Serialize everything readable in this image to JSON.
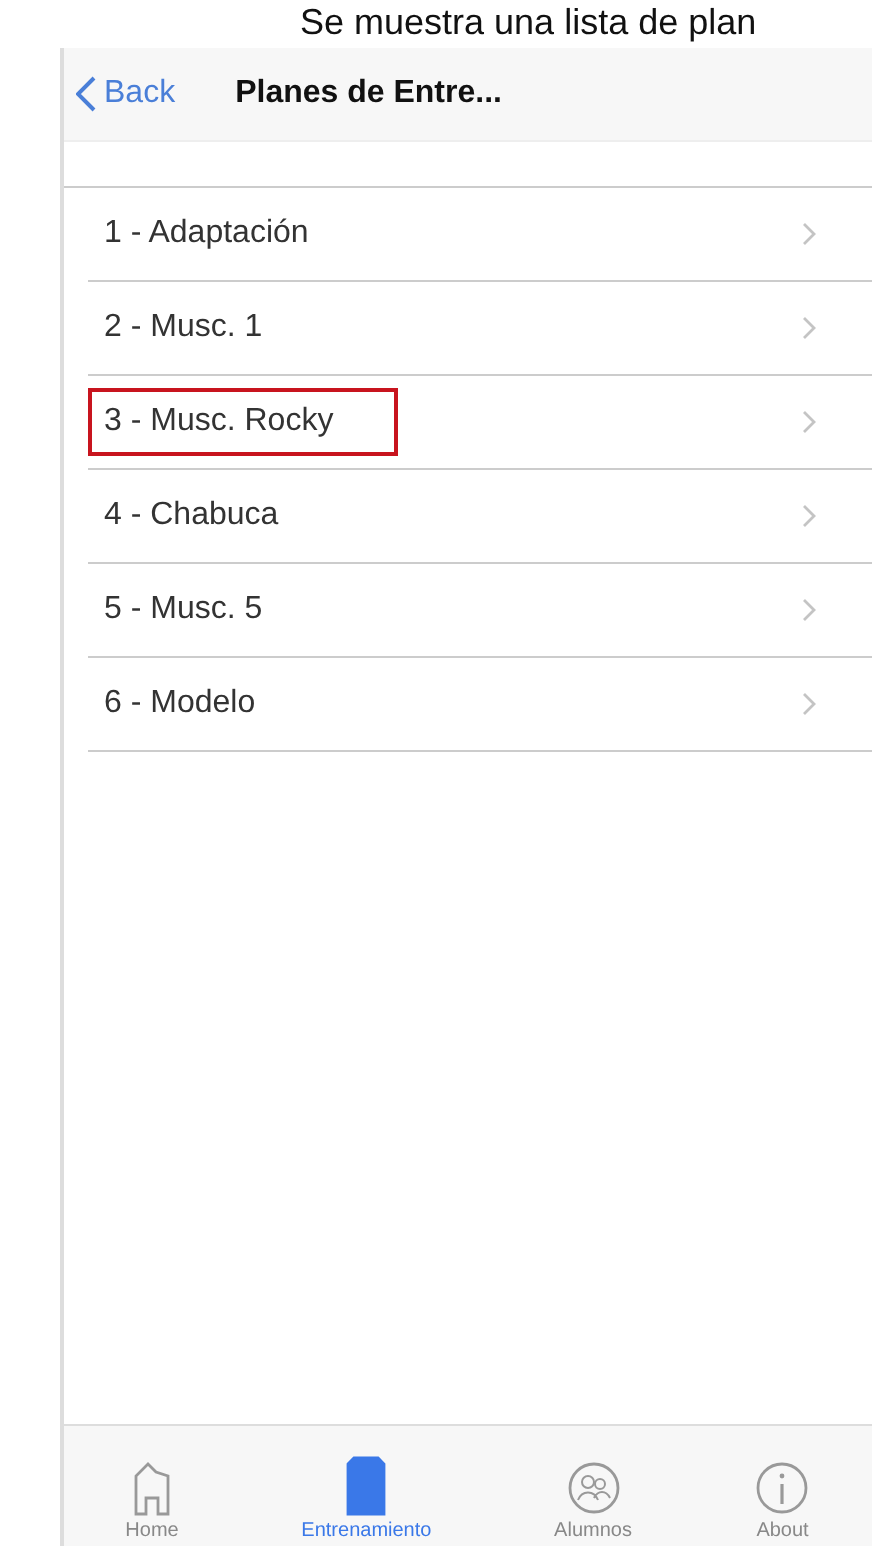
{
  "caption": "Se muestra una lista de plan",
  "nav_bar": {
    "back": "Back",
    "title": "Planes de Entre..."
  },
  "plans": [
    {
      "label": "1 - Adaptación",
      "highlighted": false
    },
    {
      "label": "2 - Musc. 1",
      "highlighted": false
    },
    {
      "label": "3 - Musc. Rocky",
      "highlighted": true
    },
    {
      "label": "4 - Chabuca",
      "highlighted": false
    },
    {
      "label": "5 - Musc. 5",
      "highlighted": false
    },
    {
      "label": "6 - Modelo",
      "highlighted": false
    }
  ],
  "tab_bar": [
    {
      "kind": "home",
      "label": "Home",
      "selected": false
    },
    {
      "kind": "training",
      "label": "Entrenamiento",
      "selected": true
    },
    {
      "kind": "students",
      "label": "Alumnos",
      "selected": false
    },
    {
      "kind": "about",
      "label": "About",
      "selected": false
    }
  ]
}
